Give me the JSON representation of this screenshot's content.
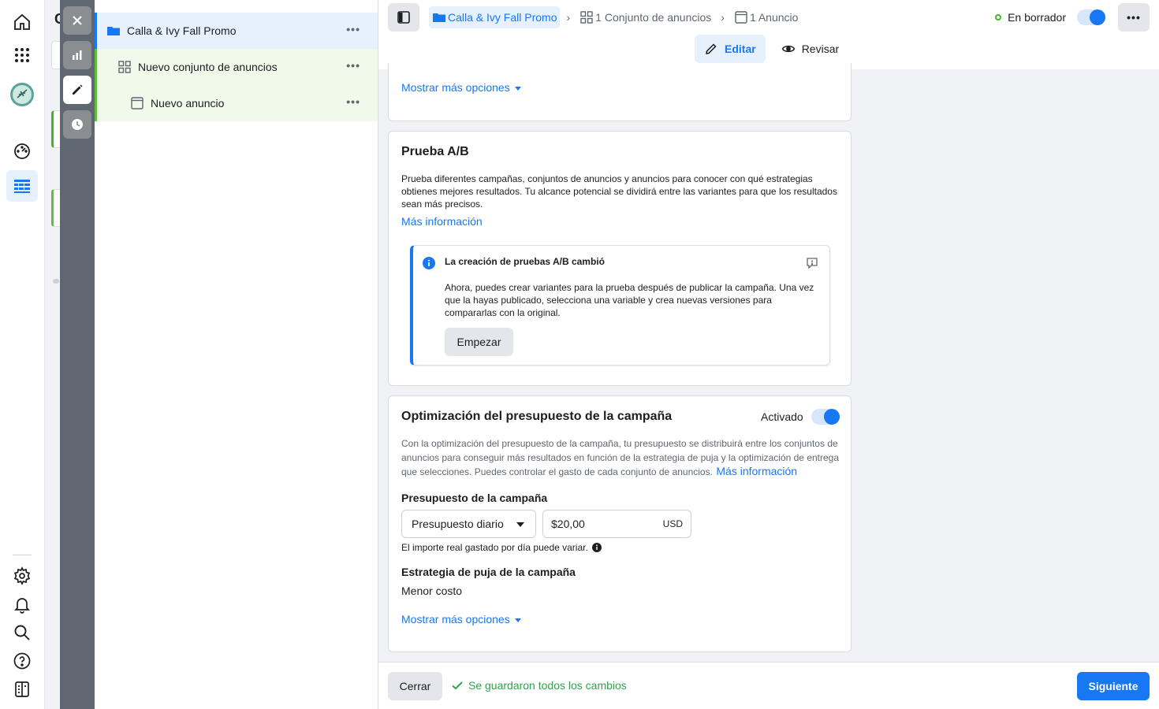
{
  "app": {
    "peek_letter": "C"
  },
  "tree": {
    "campaign": "Calla & Ivy Fall Promo",
    "adset": "Nuevo conjunto de anuncios",
    "ad": "Nuevo anuncio",
    "more": "•••"
  },
  "topbar": {
    "crumbs": [
      "Calla & Ivy Fall Promo",
      "1 Conjunto de anuncios",
      "1 Anuncio"
    ],
    "status": "En borrador",
    "more": "•••",
    "tabs": {
      "edit": "Editar",
      "review": "Revisar"
    }
  },
  "top_card": {
    "show_more": "Mostrar más opciones"
  },
  "ab_test": {
    "title": "Prueba A/B",
    "description": "Prueba diferentes campañas, conjuntos de anuncios y anuncios para conocer con qué estrategias obtienes mejores resultados. Tu alcance potencial se dividirá entre las variantes para que los resultados sean más precisos.",
    "learn_more": "Más información",
    "notice_title": "La creación de pruebas A/B cambió",
    "notice_body": "Ahora, puedes crear variantes para la prueba después de publicar la campaña. Una vez que la hayas publicado, selecciona una variable y crea nuevas versiones para compararlas con la original.",
    "start_button": "Empezar"
  },
  "budget_opt": {
    "title": "Optimización del presupuesto de la campaña",
    "toggle_label": "Activado",
    "description": "Con la optimización del presupuesto de la campaña, tu presupuesto se distribuirá entre los conjuntos de anuncios para conseguir más resultados en función de la estrategia de puja y la optimización de entrega que selecciones. Puedes controlar el gasto de cada conjunto de anuncios.",
    "learn_more": "Más información",
    "budget_label": "Presupuesto de la campaña",
    "budget_type": "Presupuesto diario",
    "budget_value": "$20,00",
    "currency": "USD",
    "budget_note": "El importe real gastado por día puede variar.",
    "bid_label": "Estrategia de puja de la campaña",
    "bid_value": "Menor costo",
    "show_more": "Mostrar más opciones"
  },
  "footer": {
    "close": "Cerrar",
    "saved": "Se guardaron todos los cambios",
    "next": "Siguiente"
  },
  "colors": {
    "accent": "#1877f2",
    "success": "#42b72a",
    "tree_active": "#e7f0fd",
    "tree_child": "#f0f9ea"
  }
}
